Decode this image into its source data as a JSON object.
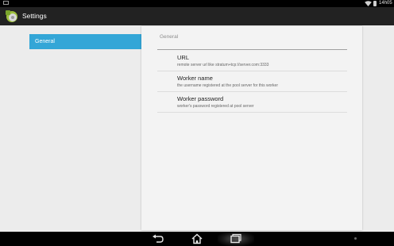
{
  "status_bar": {
    "time": "14h05",
    "icons": [
      "notification-icon",
      "wifi-icon",
      "battery-icon"
    ]
  },
  "action_bar": {
    "title": "Settings",
    "app_icon": "app-gear-icon"
  },
  "headers": {
    "items": [
      {
        "label": "General",
        "selected": true
      }
    ]
  },
  "details": {
    "category_title": "General",
    "preferences": [
      {
        "title": "URL",
        "summary": "remote server url like stratum+tcp://server.com:3333"
      },
      {
        "title": "Worker name",
        "summary": "the username registered at the pool server for this worker"
      },
      {
        "title": "Worker password",
        "summary": "worker's password registered at pool server"
      }
    ]
  },
  "nav_bar": {
    "buttons": [
      "back-icon",
      "home-icon",
      "recent-apps-icon"
    ]
  },
  "colors": {
    "accent": "#33a6d7",
    "action_bar": "#222222",
    "background": "#ececec",
    "card": "#f3f3f3"
  }
}
